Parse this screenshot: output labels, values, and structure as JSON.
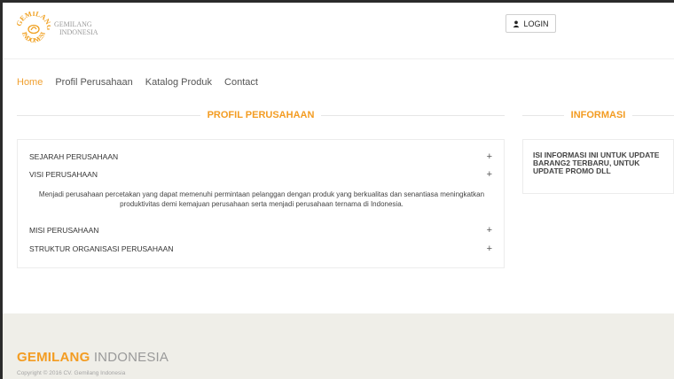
{
  "brand": {
    "logo_line1": "GEMILANG",
    "logo_line2": "INDONESIA",
    "logo_mark_top": "GEMILANG",
    "logo_mark_bottom": "INDONESIA"
  },
  "header": {
    "login_label": "LOGIN"
  },
  "nav": {
    "items": [
      {
        "label": "Home",
        "active": true
      },
      {
        "label": "Profil Perusahaan",
        "active": false
      },
      {
        "label": "Katalog Produk",
        "active": false
      },
      {
        "label": "Contact",
        "active": false
      }
    ]
  },
  "main": {
    "section_title": "PROFIL PERUSAHAAN",
    "accordion": [
      {
        "title": "SEJARAH PERUSAHAAN",
        "toggle": "+"
      },
      {
        "title": "VISI PERUSAHAAN",
        "toggle": "+"
      },
      {
        "title": "MISI PERUSAHAAN",
        "toggle": "+"
      },
      {
        "title": "STRUKTUR ORGANISASI PERUSAHAAN",
        "toggle": "+"
      }
    ],
    "visi_body": "Menjadi perusahaan percetakan yang dapat memenuhi permintaan pelanggan dengan produk yang berkualitas dan senantiasa meningkatkan produktivitas demi kemajuan perusahaan serta menjadi perusahaan ternama di Indonesia."
  },
  "sidebar": {
    "section_title": "INFORMASI",
    "info_text": "ISI INFORMASI INI UNTUK UPDATE BARANG2 TERBARU, UNTUK UPDATE PROMO DLL"
  },
  "footer": {
    "brand_bold": "GEMILANG",
    "brand_light": "INDONESIA",
    "copyright": "Copyright © 2016 CV. Gemilang Indonesia"
  },
  "colors": {
    "accent": "#f39c22",
    "footer_bg": "#efeee8"
  }
}
